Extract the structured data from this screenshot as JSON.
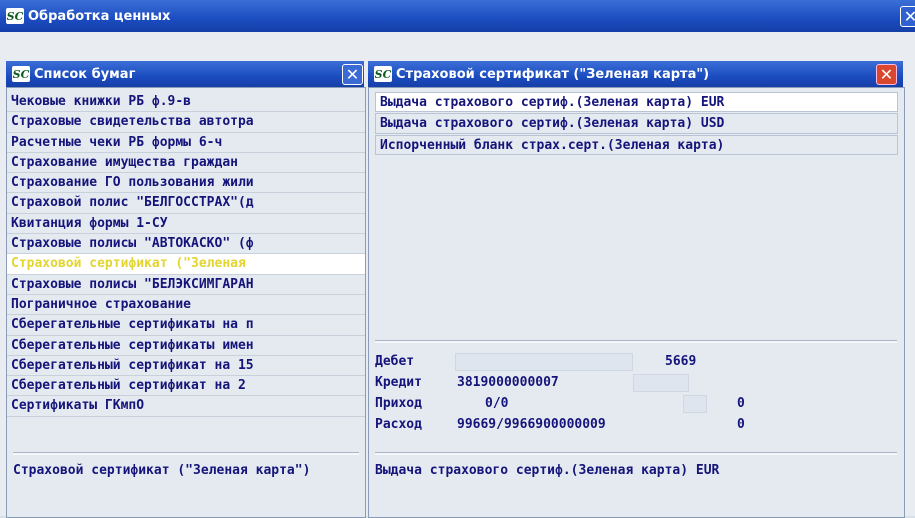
{
  "main_window": {
    "title": "Обработка ценных",
    "close_glyph": "✕"
  },
  "list_window": {
    "title": "Список бумаг",
    "close_glyph": "✕",
    "items": [
      "Чековые книжки РБ ф.9-в",
      "Страховые свидетельства автотра",
      "Расчетные чеки РБ формы 6-ч",
      "Страхование имущества граждан",
      "Страхование ГО пользования жили",
      "Страховой полис \"БЕЛГОССТРАХ\"(д",
      "Квитанция формы 1-СУ",
      "Страховые полисы \"АВТОКАСКО\" (ф",
      "Страховой сертификат (\"Зеленая",
      "Страховые полисы \"БЕЛЭКСИМГАРАН",
      "Пограничное страхование",
      "Сберегательные сертификаты на п",
      "Сберегательные сертификаты имен",
      "Сберегательный сертификат на 15",
      "Сберегательный сертификат на 2",
      "Сертификаты ГКмпО"
    ],
    "selected_index": 8,
    "description": "Страховой сертификат (\"Зеленая карта\")"
  },
  "cert_window": {
    "title": "Страховой сертификат (\"Зеленая карта\")",
    "close_glyph": "✕",
    "items": [
      "Выдача страхового сертиф.(Зеленая карта) EUR",
      "Выдача страхового сертиф.(Зеленая карта) USD",
      "Испорченный бланк страх.серт.(Зеленая карта)"
    ],
    "selected_index": 0,
    "stats": {
      "debit_label": "Дебет",
      "debit_value": "5669",
      "credit_label": "Кредит",
      "credit_value": "3819000000007",
      "income_label": "Приход",
      "income_value": "0/0",
      "income_count": "0",
      "expense_label": "Расход",
      "expense_value": "99669/9966900000009",
      "expense_count": "0"
    },
    "description": "Выдача страхового сертиф.(Зеленая карта) EUR"
  },
  "icons": {
    "logo": "SC"
  },
  "colors": {
    "title_blue": "#1b4cc0",
    "selected_text": "#e2d530",
    "text": "#14147a",
    "close_red": "#d9482e"
  }
}
